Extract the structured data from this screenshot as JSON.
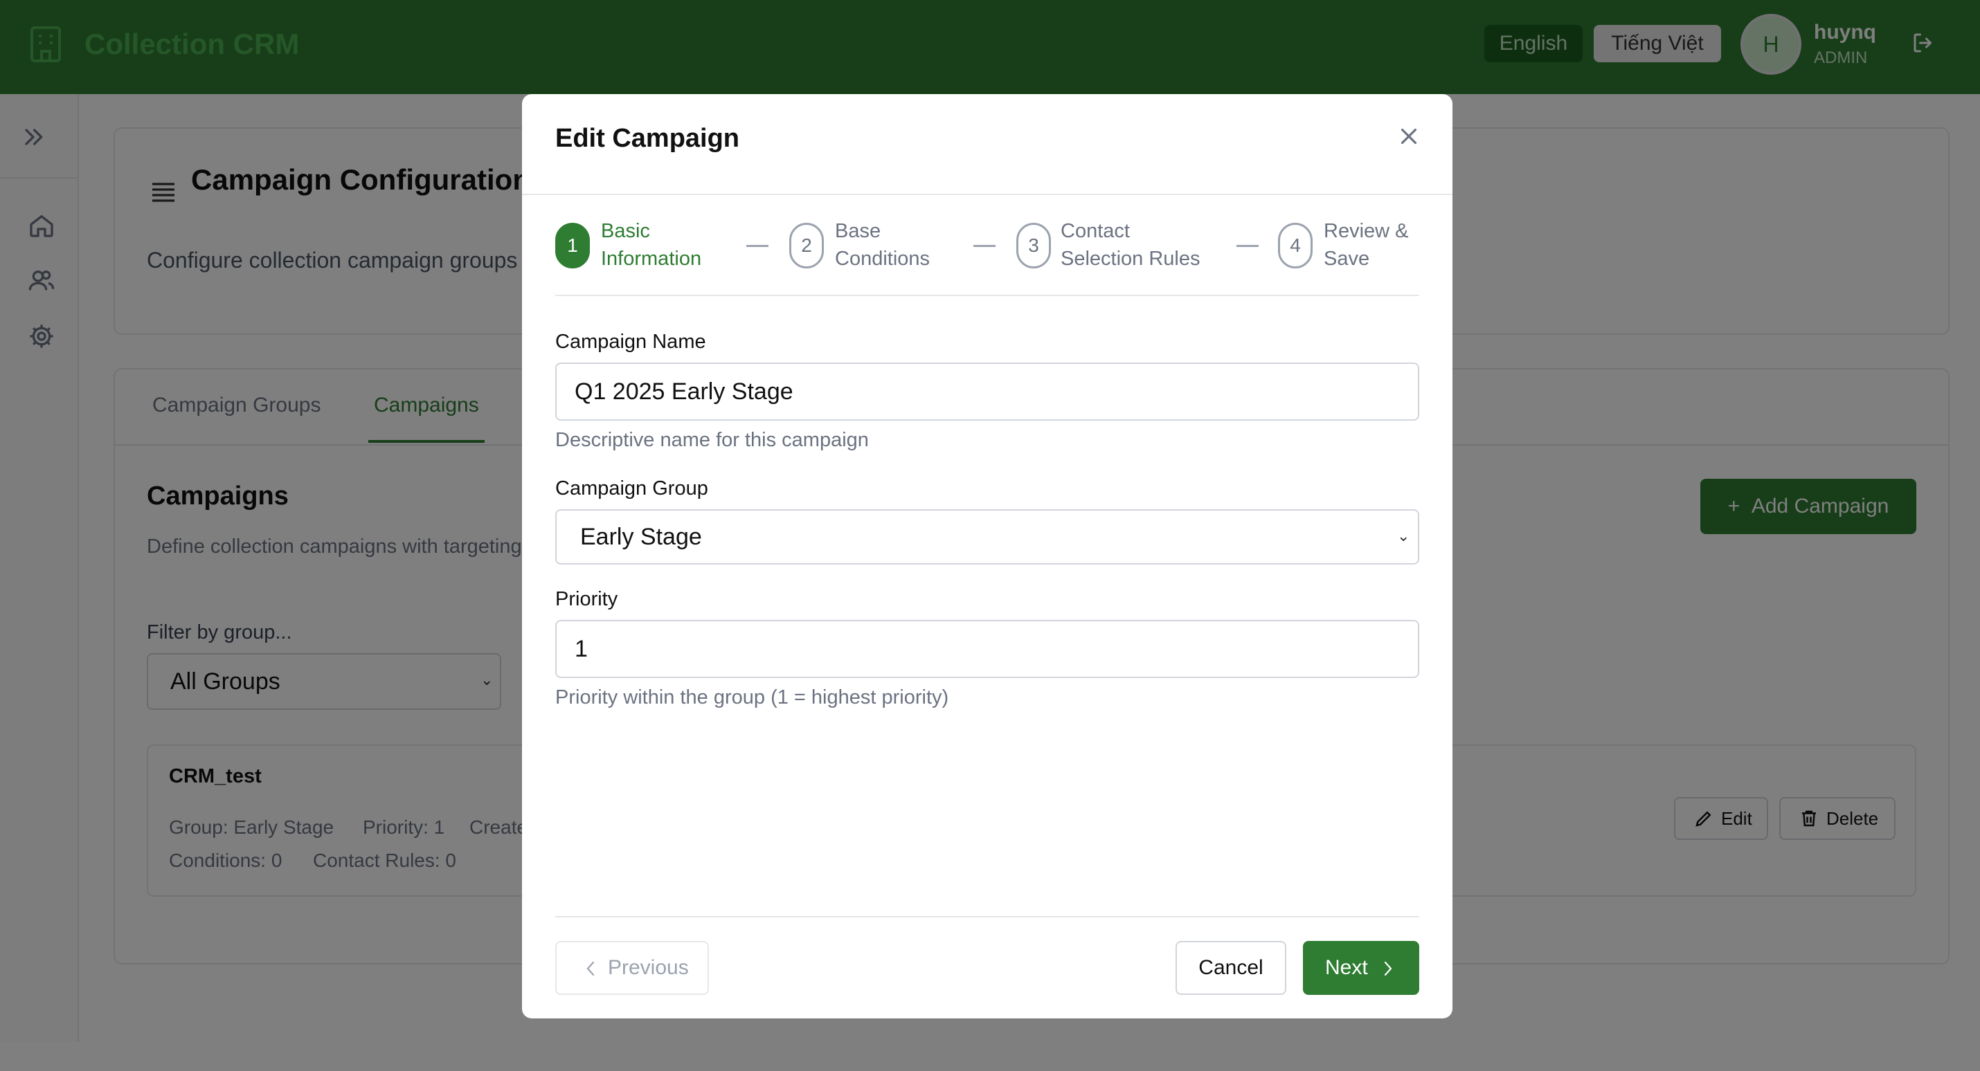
{
  "app": {
    "title": "Collection CRM"
  },
  "header": {
    "lang_english": "English",
    "lang_vietnamese": "Tiếng Việt",
    "avatar_initial": "H",
    "user_name": "huynq",
    "user_role": "ADMIN"
  },
  "page": {
    "title": "Campaign Configuration",
    "description": "Configure collection campaign groups"
  },
  "tabs": [
    {
      "label": "Campaign Groups"
    },
    {
      "label": "Campaigns"
    }
  ],
  "campaigns_section": {
    "title": "Campaigns",
    "description": "Define collection campaigns with targeting",
    "add_button": "Add Campaign",
    "filter_label": "Filter by group...",
    "filter_value": "All Groups"
  },
  "campaign_item": {
    "name": "CRM_test",
    "group": "Group: Early Stage",
    "priority": "Priority: 1",
    "created": "Created",
    "conditions": "Conditions: 0",
    "contact_rules": "Contact Rules: 0",
    "edit_label": "Edit",
    "delete_label": "Delete"
  },
  "modal": {
    "title": "Edit Campaign",
    "steps": [
      {
        "number": "1",
        "line1": "Basic",
        "line2": "Information"
      },
      {
        "number": "2",
        "line1": "Base",
        "line2": "Conditions"
      },
      {
        "number": "3",
        "line1": "Contact",
        "line2": "Selection Rules"
      },
      {
        "number": "4",
        "line1": "Review &",
        "line2": "Save"
      }
    ],
    "fields": {
      "name_label": "Campaign Name",
      "name_value": "Q1 2025 Early Stage",
      "name_help": "Descriptive name for this campaign",
      "group_label": "Campaign Group",
      "group_value": "Early Stage",
      "priority_label": "Priority",
      "priority_value": "1",
      "priority_help": "Priority within the group (1 = highest priority)"
    },
    "buttons": {
      "previous": "Previous",
      "cancel": "Cancel",
      "next": "Next"
    }
  },
  "colors": {
    "primary": "#2e7d32",
    "header_bg": "#2e7d32",
    "overlay": "rgba(0,0,0,0.5)"
  }
}
